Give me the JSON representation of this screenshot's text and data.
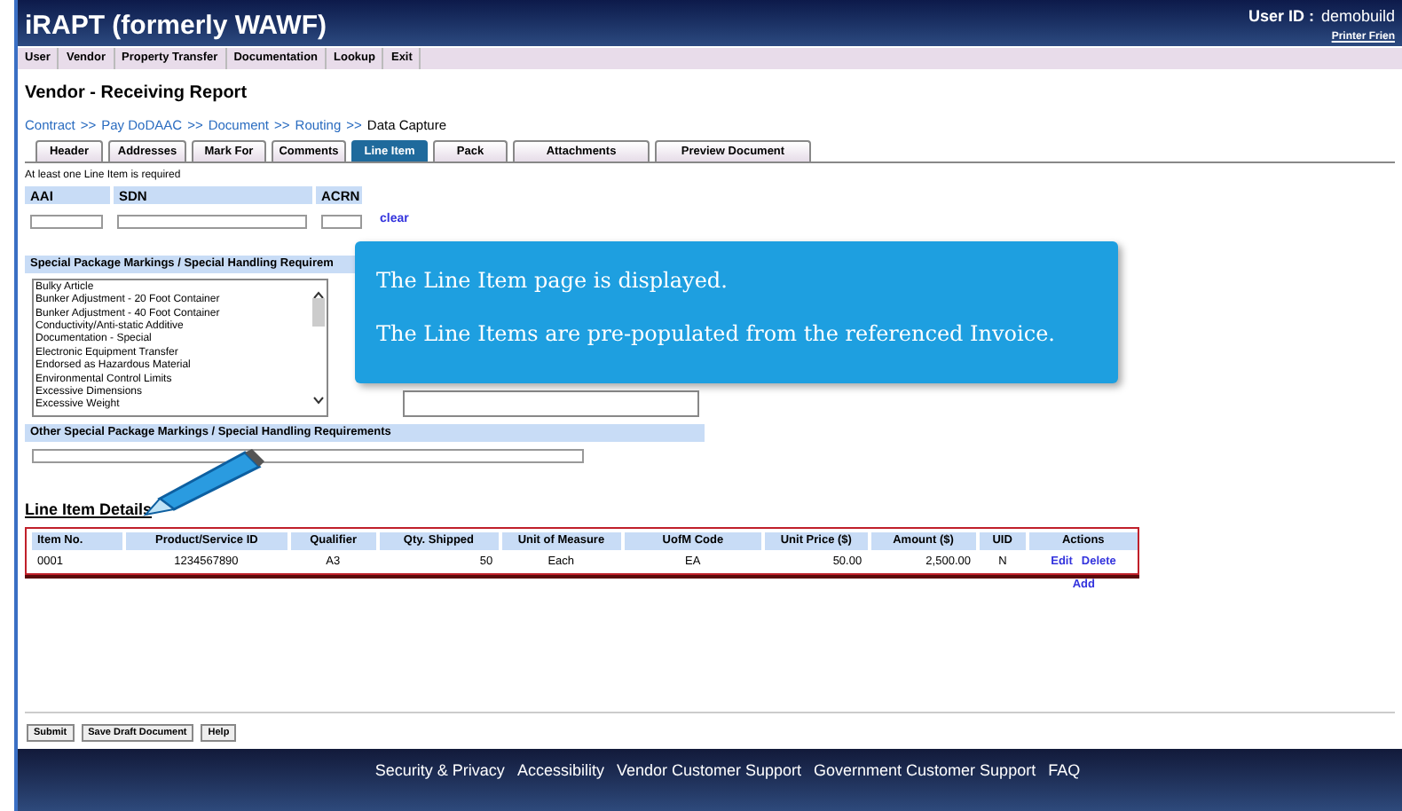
{
  "header": {
    "title": "iRAPT (formerly WAWF)",
    "user_label": "User ID :",
    "user_value": "demobuild",
    "printer_link": "Printer Frien"
  },
  "menu": [
    "User",
    "Vendor",
    "Property Transfer",
    "Documentation",
    "Lookup",
    "Exit"
  ],
  "page_title": "Vendor - Receiving Report",
  "breadcrumb": [
    {
      "label": "Contract",
      "link": true
    },
    {
      "label": "Pay DoDAAC",
      "link": true
    },
    {
      "label": "Document",
      "link": true
    },
    {
      "label": "Routing",
      "link": true
    },
    {
      "label": "Data Capture",
      "link": false
    }
  ],
  "breadcrumb_separator": ">>",
  "tabs": [
    {
      "label": "Header",
      "selected": false
    },
    {
      "label": "Addresses",
      "selected": false
    },
    {
      "label": "Mark For",
      "selected": false
    },
    {
      "label": "Comments",
      "selected": false
    },
    {
      "label": "Line Item",
      "selected": true
    },
    {
      "label": "Pack",
      "selected": false
    },
    {
      "label": "Attachments",
      "selected": false
    },
    {
      "label": "Preview Document",
      "selected": false
    }
  ],
  "notice": "At least one Line Item is required",
  "accounting": {
    "columns": [
      "AAI",
      "SDN",
      "ACRN"
    ],
    "clear_link": "clear"
  },
  "special_markings": {
    "heading": "Special Package Markings / Special Handling Requirem",
    "options": [
      "Bulky Article",
      "Bunker Adjustment - 20 Foot Container",
      "Bunker Adjustment - 40 Foot Container",
      "Conductivity/Anti-static Additive",
      "Documentation - Special",
      "Electronic Equipment Transfer",
      "Endorsed as Hazardous Material",
      "Environmental Control Limits",
      "Excessive Dimensions",
      "Excessive Weight"
    ]
  },
  "other_markings": {
    "heading": "Other Special Package Markings / Special Handling Requirements"
  },
  "line_items": {
    "heading": "Line Item Details",
    "columns": [
      "Item No.",
      "Product/Service ID",
      "Qualifier",
      "Qty. Shipped",
      "Unit of Measure",
      "UofM Code",
      "Unit Price ($)",
      "Amount ($)",
      "UID",
      "Actions"
    ],
    "rows": [
      {
        "cells": [
          "0001",
          "1234567890",
          "A3",
          "50",
          "Each",
          "EA",
          "50.00",
          "2,500.00",
          "N"
        ],
        "actions": [
          "Edit",
          "Delete"
        ]
      }
    ],
    "add_link": "Add"
  },
  "buttons": [
    "Submit",
    "Save Draft Document",
    "Help"
  ],
  "footer_links": [
    "Security & Privacy",
    "Accessibility",
    "Vendor Customer Support",
    "Government Customer Support",
    "FAQ"
  ],
  "callout": {
    "lines": [
      "The Line Item page is displayed.",
      "The Line Items are pre-populated from the referenced Invoice."
    ]
  }
}
